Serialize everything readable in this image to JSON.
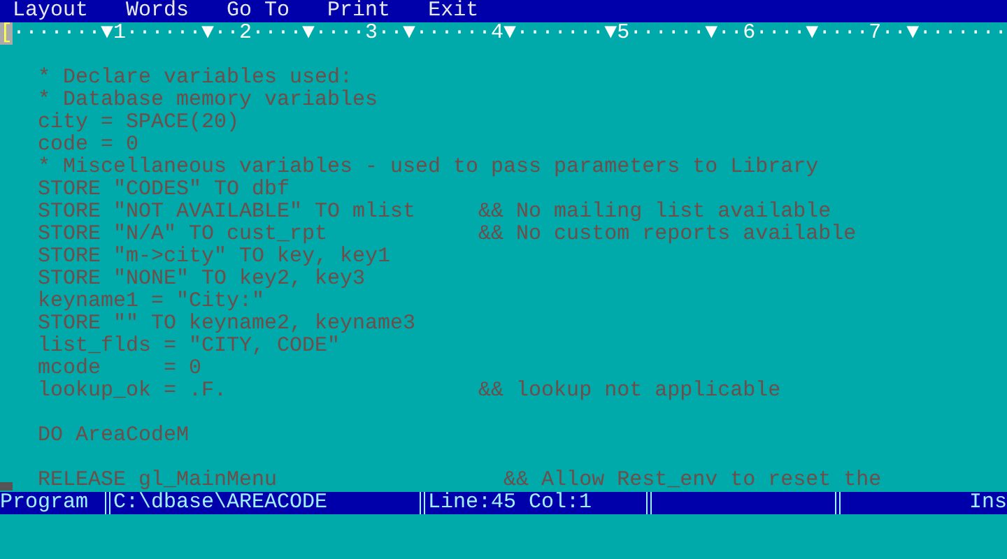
{
  "menu_bar": {
    "items": [
      "Layout",
      "Words",
      "Go To",
      "Print",
      "Exit"
    ]
  },
  "ruler": {
    "margin_mark": "[",
    "scale": "·······▼1······▼··2····▼····3··▼······4▼·······▼5······▼··6····▼····7··▼·······"
  },
  "editor": {
    "blocks": [
      {
        "lines": [
          "* Declare variables used:",
          "* Database memory variables",
          "city = SPACE(20)",
          "code = 0",
          "* Miscellaneous variables - used to pass parameters to Library",
          "STORE \"CODES\" TO dbf",
          "STORE \"NOT AVAILABLE\" TO mlist     && No mailing list available",
          "STORE \"N/A\" TO cust_rpt            && No custom reports available",
          "STORE \"m->city\" TO key, key1",
          "STORE \"NONE\" TO key2, key3",
          "keyname1 = \"City:\"",
          "STORE \"\" TO keyname2, keyname3",
          "list_flds = \"CITY, CODE\"",
          "mcode     = 0",
          "lookup_ok = .F.                    && lookup not applicable"
        ]
      },
      {
        "lines": [
          "DO AreaCodeM"
        ]
      },
      {
        "lines": [
          "RELEASE gl_MainMenu                  && Allow Rest_env to reset the"
        ]
      }
    ]
  },
  "status_bar": {
    "mode": "Program",
    "file": "C:\\dbase\\AREACODE",
    "position": "Line:45 Col:1",
    "insert_mode": "Ins"
  }
}
